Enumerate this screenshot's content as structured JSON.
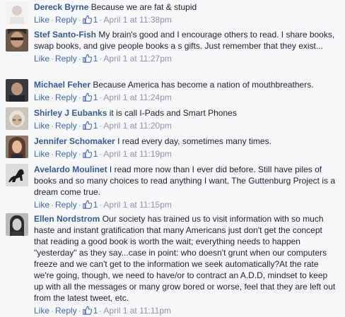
{
  "actions": {
    "like": "Like",
    "reply": "Reply",
    "separator": "·"
  },
  "comments": [
    {
      "author": "Dereck Byrne",
      "text": "Because we are fat & stupid",
      "likes": "1",
      "time": "April 1 at 11:38pm"
    },
    {
      "author": "Stef Santo-Fish",
      "text": "My brain's good and I encourage others to read. I share books, swap books, and give people books a s gifts. Just remember that they exist...",
      "likes": "1",
      "time": "April 1 at 11:27pm"
    },
    {
      "author": "Michael Feher",
      "text": "Because America has become a nation of mouthbreathers.",
      "likes": "1",
      "time": "April 1 at 11:24pm"
    },
    {
      "author": "Shirley J Eubanks",
      "text": "it is call I-Pads and Smart Phones",
      "likes": "1",
      "time": "April 1 at 11:20pm"
    },
    {
      "author": "Jennifer Schomaker",
      "text": "I read every day, sometimes many times.",
      "likes": "1",
      "time": "April 1 at 11:19pm"
    },
    {
      "author": "Avelardo Moulinet",
      "text": "I read more now than I ever did before. Still have piles of books and so many choices to read anything I want. The Guttenburg Project is a dream come true.",
      "likes": "1",
      "time": "April 1 at 11:15pm"
    },
    {
      "author": "Ellen Nordstrom",
      "text": "Our society has trained us to visit information with so much haste and instant gratification that many Americans just don't get the concept that reading a good book is worth the wait; everything needs to happen \"yesterday\" as they say...case in point: who doesn't grunt when our computers freeze and we can't get to the information we seek automatically?At the rate we're going, though, we need to have/or to contract an A.D.D, mindset to keep up with all the messages or many grow bored or worse, feel that they are left out from the latest tweet, etc.",
      "likes": "1",
      "time": "April 1 at 11:11pm"
    }
  ]
}
